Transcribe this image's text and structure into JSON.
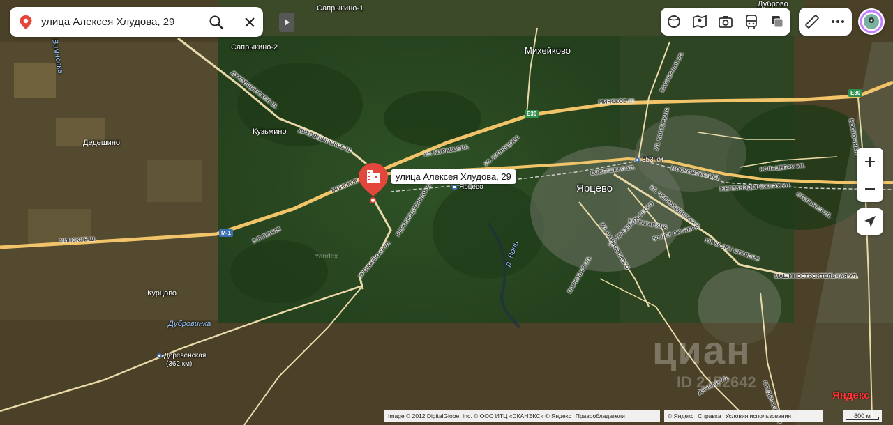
{
  "search": {
    "query": "улица Алексея Хлудова, 29"
  },
  "icons": {
    "location_pin": "map-pin-icon",
    "search": "search-icon",
    "close": "close-icon",
    "collapse": "chevron-right-icon",
    "layers": [
      "map-style-icon",
      "panorama-icon",
      "camera-icon",
      "transport-icon",
      "layers-icon"
    ],
    "tools": [
      "ruler-icon",
      "more-icon"
    ],
    "locate": "locate-arrow-icon"
  },
  "marker": {
    "label": "улица Алексея Хлудова, 29",
    "color": "#e3463b"
  },
  "places": {
    "yartsevo": "Ярцево",
    "mikheykovo": "Михейково",
    "saprykino1": "Сапрыкино-1",
    "saprykino2": "Сапрыкино-2",
    "kuzmino": "Кузьмино",
    "dedeshino": "Дедешино",
    "kurtsovo": "Курцово",
    "dubrovo": "Дуброво",
    "yandex_tag": "Yandex"
  },
  "rivers": {
    "dubrovinka": "Дубровинка",
    "vop": "р. Вопь",
    "top_left": "Вимновка"
  },
  "streets": {
    "minskoe_sh_left": "МИНСКОЕ Ш.",
    "minskoe_sh_mid": "МИНСКОЕ",
    "minskoe_sh_right": "МИНСКОЕ Ш.",
    "dukhovshchinskoe_1": "ДУХОВЩИНСКОЕ Ш.",
    "dukhovshchinskoe_2": "ДУХОВЩИНСКОЕ Ш.",
    "line3": "3-Я ЛИНИЯ",
    "muraveva": "УЛ. МУРАВЬЕВА",
    "kuznetsova": "УЛ. КУЗНЕЦОВА",
    "revolyutsionnaya": "РЕВОЛЮЦИОННАЯ УЛ.",
    "urozhaynaya": "УРОЖАЙНАЯ УЛ.",
    "sovetskaya": "СОВЕТСКАЯ УЛ.",
    "moskovskaya": "МОСКОВСКАЯ УЛ.",
    "koltsevaya": "КОЛЬЦЕВАЯ УЛ.",
    "zheleznodorozhnaya": "ЖЕЛЕЗНОДОРОЖНАЯ УЛ.",
    "stelnaya": "СТЕЛЬНАЯ УЛ.",
    "vostochnaya": "ВОСТОЧНАЯ",
    "zaozernaya": "ЗАОЗЕРНАЯ УЛ.",
    "kaptsurina": "УЛ. КАПТУРИНА",
    "chernyshevskogo": "УЛ. ЧЕРНЫШЕВСКОГО",
    "gagarina": "УЛ. ГАГАРИНА",
    "oktyabrya_50": "50 ЛЕТ ОКТЯБРЯ",
    "oktyabrya_50b": "УЛ. 50 ЛЕТ ОКТЯБРЯ",
    "mashinostroitelnaya": "МАШИНОСТРОИТЕЛЬНАЯ УЛ.",
    "przhevalskogo": "УЛ. ПРЖЕВАЛЬСКОГО",
    "chaykovskogo": "УЛ. ЧАЙКОВСКОГО",
    "parkovaya": "ПАРКОВАЯ УЛ.",
    "dachnaya": "ДАЧНАЯ УЛ.",
    "studencheskaya": "СТУДЕНЧЕСКАЯ"
  },
  "shields": {
    "e30_top": "E30",
    "e30_mid": "E30",
    "m1": "M-1"
  },
  "stations": {
    "yartsevo_station": "Ярцево",
    "km353": "353 км",
    "derevenskaya": "Деревенская",
    "derevenskaya_km": "(362 км)"
  },
  "watermark": {
    "brand": "циан",
    "id": "ID 2152642"
  },
  "attribution": {
    "imagery": "Image © 2012 DigitalGlobe, Inc. © ООО ИТЦ «СКАНЭКС» © Яндекс",
    "rightholders": "Правообладатели",
    "yandex": "© Яндекс",
    "help": "Справка",
    "terms": "Условия использования",
    "logo": "Яндекс",
    "scale": "800 м"
  },
  "colors": {
    "road_major": "#f2c46a",
    "road_minor": "#e9d9a8",
    "satellite_green": "#2c4a23",
    "satellite_brown": "#4b4127",
    "accent_red": "#e3463b"
  }
}
